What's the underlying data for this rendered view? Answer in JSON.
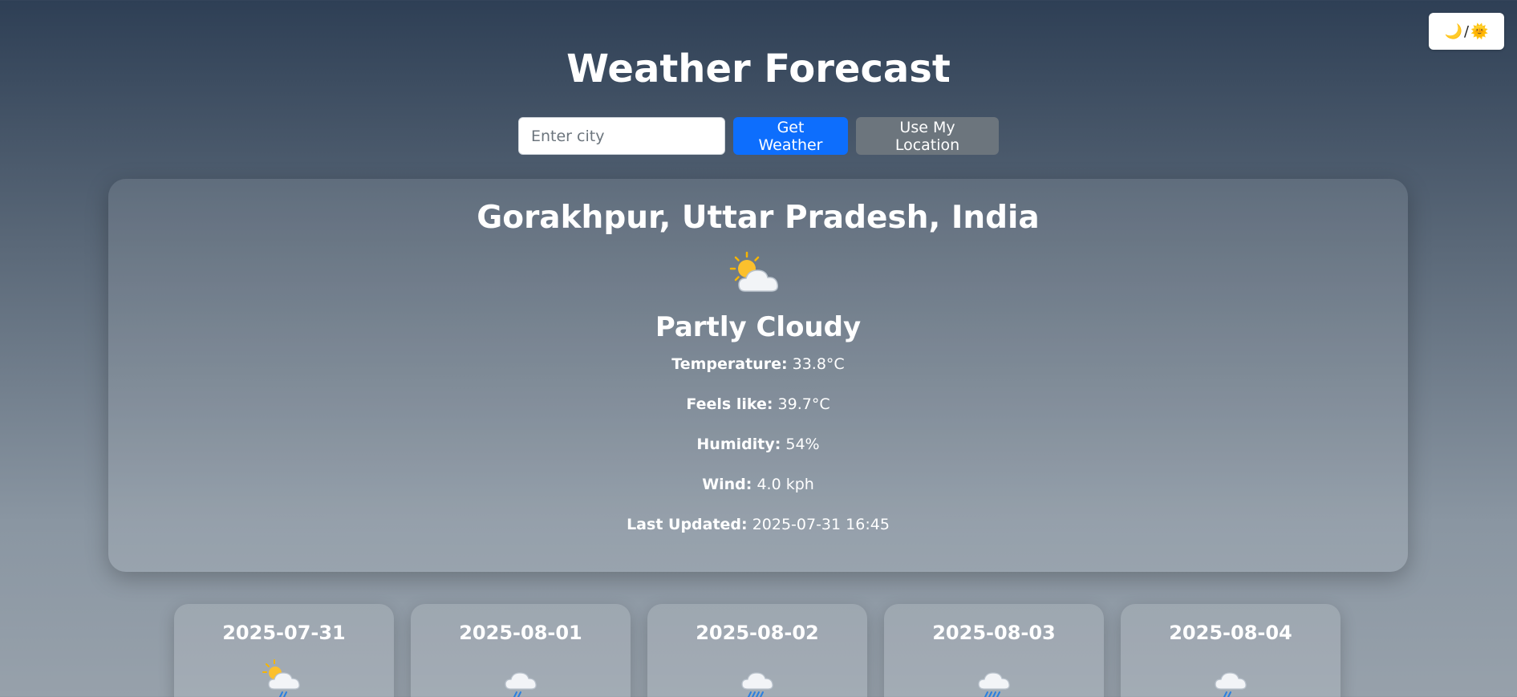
{
  "theme_toggle": {
    "moon": "🌙",
    "separator": "/",
    "sun": "🌞"
  },
  "header": {
    "title": "Weather Forecast"
  },
  "search": {
    "placeholder": "Enter city",
    "value": "",
    "get_weather_label": "Get Weather",
    "use_location_label": "Use My Location"
  },
  "current": {
    "location": "Gorakhpur, Uttar Pradesh, India",
    "icon": "partly-cloudy-icon",
    "condition": "Partly Cloudy",
    "temperature_label": "Temperature:",
    "temperature_value": "33.8°C",
    "feels_like_label": "Feels like:",
    "feels_like_value": "39.7°C",
    "humidity_label": "Humidity:",
    "humidity_value": "54%",
    "wind_label": "Wind:",
    "wind_value": "4.0 kph",
    "last_updated_label": "Last Updated:",
    "last_updated_value": "2025-07-31 16:45"
  },
  "forecast": [
    {
      "date": "2025-07-31",
      "icon": "sun-cloud-rain-icon"
    },
    {
      "date": "2025-08-01",
      "icon": "light-rain-icon"
    },
    {
      "date": "2025-08-02",
      "icon": "heavy-rain-icon"
    },
    {
      "date": "2025-08-03",
      "icon": "heavy-rain-icon"
    },
    {
      "date": "2025-08-04",
      "icon": "light-rain-icon"
    }
  ],
  "colors": {
    "primary_button": "#0d6efd",
    "secondary_button": "#6c757d",
    "rain": "#2b7fe0",
    "sun": "#f7b500"
  }
}
